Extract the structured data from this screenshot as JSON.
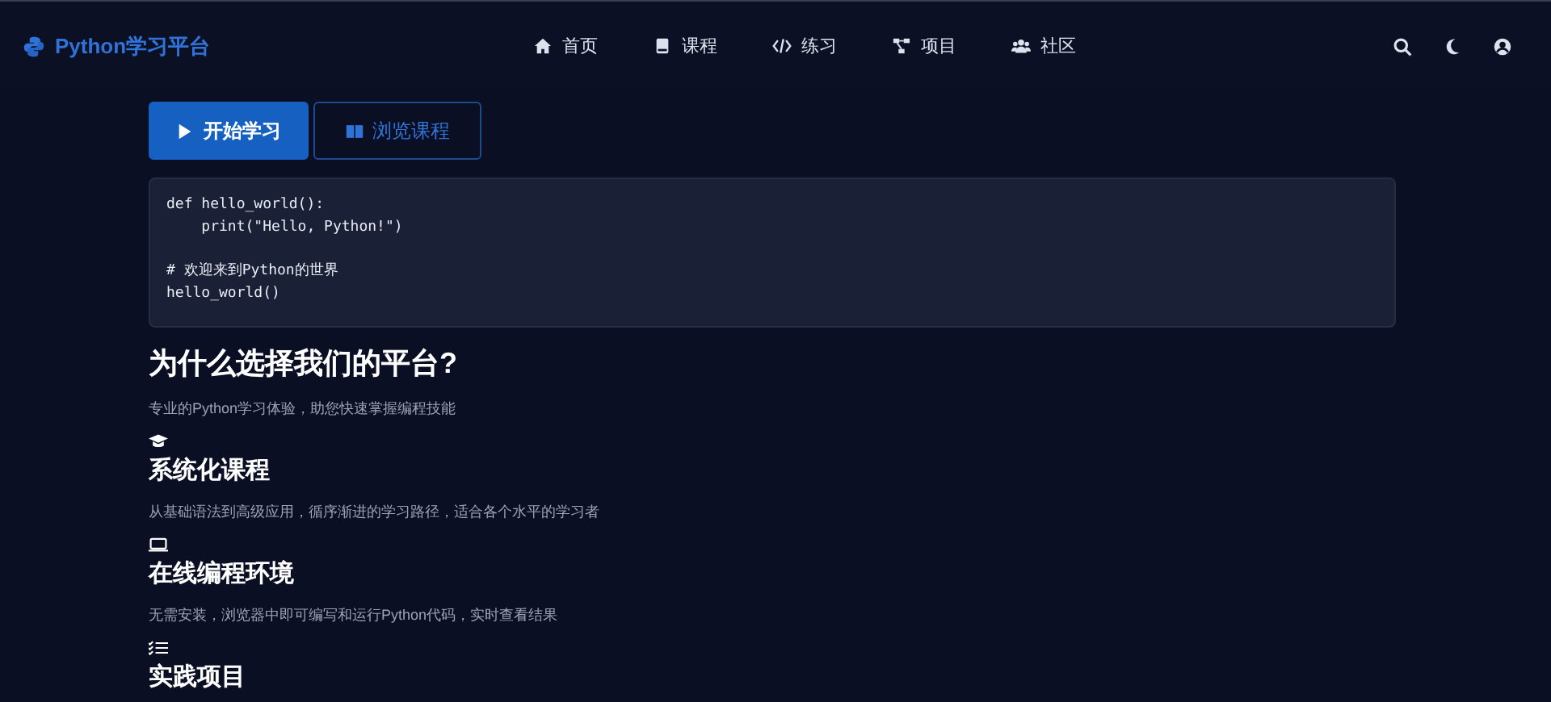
{
  "brand": "Python学习平台",
  "nav": [
    {
      "label": "首页"
    },
    {
      "label": "课程"
    },
    {
      "label": "练习"
    },
    {
      "label": "项目"
    },
    {
      "label": "社区"
    }
  ],
  "hero_buttons": [
    {
      "label": "开始学习",
      "kind": "primary"
    },
    {
      "label": "浏览课程",
      "kind": "outline"
    }
  ],
  "code": "def hello_world():\n    print(\"Hello, Python!\")\n\n# 欢迎来到Python的世界\nhello_world()",
  "section": {
    "title": "为什么选择我们的平台?",
    "subtitle": "专业的Python学习体验，助您快速掌握编程技能"
  },
  "features": [
    {
      "title": "系统化课程",
      "description": "从基础语法到高级应用，循序渐进的学习路径，适合各个水平的学习者"
    },
    {
      "title": "在线编程环境",
      "description": "无需安装，浏览器中即可编写和运行Python代码，实时查看结果"
    },
    {
      "title": "实践项目"
    }
  ]
}
